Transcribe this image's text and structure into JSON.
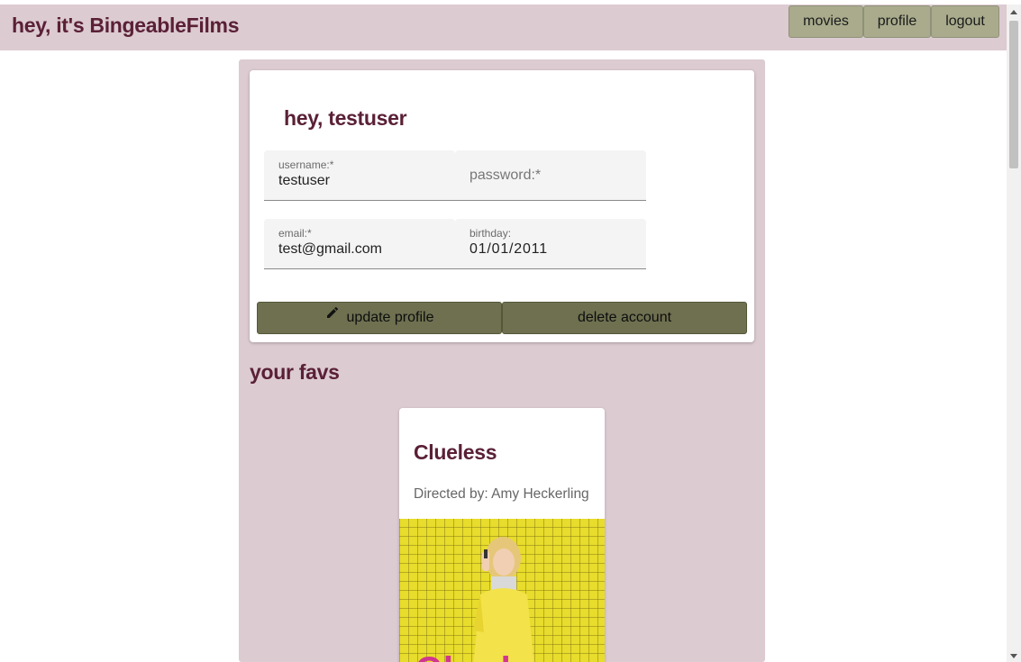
{
  "navbar": {
    "brand": "hey, it's BingeableFilms",
    "links": [
      "movies",
      "profile",
      "logout"
    ]
  },
  "profile": {
    "greeting": "hey, testuser",
    "fields": {
      "username": {
        "label": "username:*",
        "value": "testuser"
      },
      "password": {
        "placeholder": "password:*"
      },
      "email": {
        "label": "email:*",
        "value": "test@gmail.com"
      },
      "birthday": {
        "label": "birthday:",
        "value": "01/01/2011"
      }
    },
    "buttons": {
      "update": "update profile",
      "delete": "delete account"
    }
  },
  "favs": {
    "title": "your favs",
    "movies": [
      {
        "title": "Clueless",
        "director": "Directed by: Amy Heckerling",
        "poster_text": "Clueless"
      }
    ]
  },
  "colors": {
    "accent": "#5a2036",
    "panel": "#dccbd1",
    "nav_button": "#a9ab8c",
    "action_button": "#6e7050"
  },
  "icons": [
    "pencil-icon"
  ]
}
